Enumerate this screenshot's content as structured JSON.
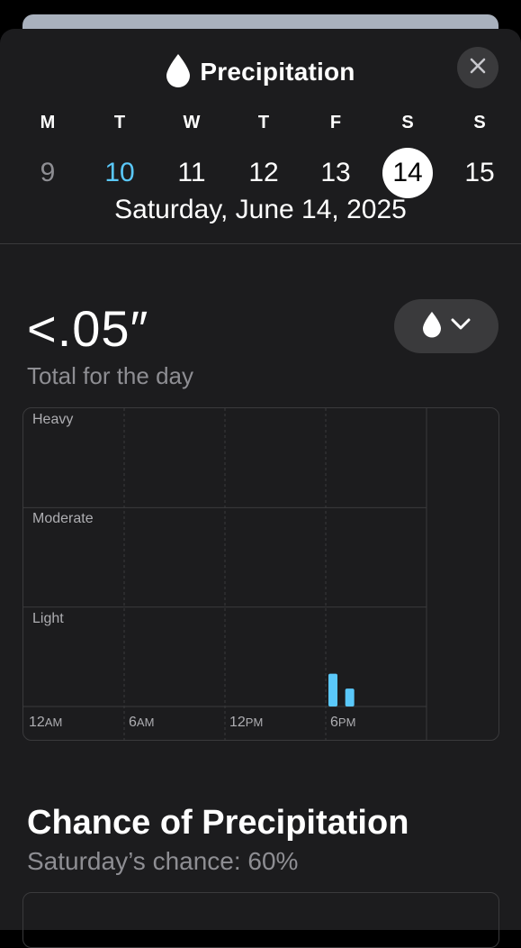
{
  "header": {
    "title": "Precipitation",
    "icon": "raindrop-icon",
    "close_icon": "close-icon"
  },
  "week": [
    {
      "weekday": "M",
      "day": "9",
      "state": "past"
    },
    {
      "weekday": "T",
      "day": "10",
      "state": "today"
    },
    {
      "weekday": "W",
      "day": "11",
      "state": "normal"
    },
    {
      "weekday": "T",
      "day": "12",
      "state": "normal"
    },
    {
      "weekday": "F",
      "day": "13",
      "state": "normal"
    },
    {
      "weekday": "S",
      "day": "14",
      "state": "selected"
    },
    {
      "weekday": "S",
      "day": "15",
      "state": "normal"
    }
  ],
  "selected_date": "Saturday, June 14, 2025",
  "summary": {
    "total_value": "<.05″",
    "total_label": "Total for the day",
    "metric_button_icon": "raindrop-icon",
    "metric_button_chevron": "chevron-down-icon"
  },
  "chart_data": {
    "type": "bar",
    "levels": [
      "Heavy",
      "Moderate",
      "Light"
    ],
    "x_ticks": [
      {
        "hour": "12",
        "suffix": "AM"
      },
      {
        "hour": "6",
        "suffix": "AM"
      },
      {
        "hour": "12",
        "suffix": "PM"
      },
      {
        "hour": "6",
        "suffix": "PM"
      }
    ],
    "x": [
      18,
      19
    ],
    "values": [
      0.11,
      0.06
    ],
    "ylim": [
      0,
      1
    ],
    "bar_color": "#5ac8fa"
  },
  "chance": {
    "title": "Chance of Precipitation",
    "subtitle": "Saturday’s chance: 60%"
  },
  "colors": {
    "background": "#1c1c1e",
    "accent_today": "#5ac8fa",
    "muted": "#8e8e93"
  }
}
